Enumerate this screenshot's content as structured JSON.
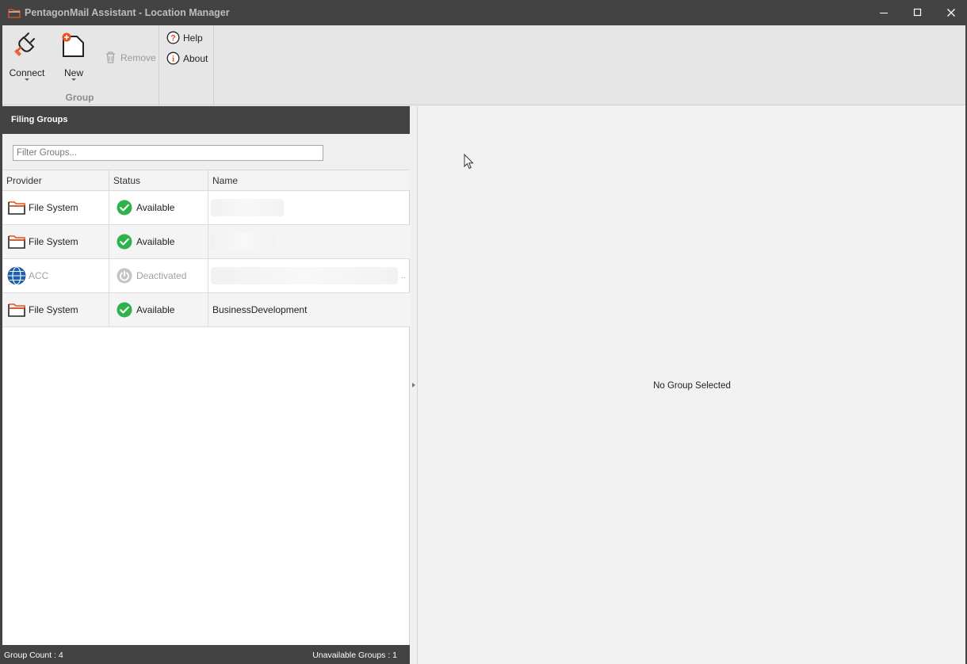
{
  "window": {
    "title": "PentagonMail Assistant - Location Manager",
    "controls": [
      "minimize",
      "maximize",
      "close"
    ]
  },
  "ribbon": {
    "connect_label": "Connect",
    "new_label": "New",
    "remove_label": "Remove",
    "group_label": "Group",
    "help_label": "Help",
    "about_label": "About"
  },
  "filing_groups": {
    "header": "Filing Groups",
    "filter_placeholder": "Filter Groups...",
    "columns": {
      "provider": "Provider",
      "status": "Status",
      "name": "Name"
    },
    "rows": [
      {
        "provider": "File System",
        "status": "Available",
        "name": "",
        "name_redacted": true,
        "deactivated": false,
        "provider_icon": "folder-icon",
        "status_icon": "check-circle-icon"
      },
      {
        "provider": "File System",
        "status": "Available",
        "name": "",
        "name_redacted": true,
        "deactivated": false,
        "provider_icon": "folder-icon",
        "status_icon": "check-circle-icon"
      },
      {
        "provider": "ACC",
        "status": "Deactivated",
        "name": "",
        "name_redacted": true,
        "deactivated": true,
        "provider_icon": "globe-icon",
        "status_icon": "power-icon"
      },
      {
        "provider": "File System",
        "status": "Available",
        "name": "BusinessDevelopment",
        "name_redacted": false,
        "deactivated": false,
        "provider_icon": "folder-icon",
        "status_icon": "check-circle-icon"
      }
    ],
    "status_bar": {
      "group_count": "Group Count : 4",
      "unavailable_groups": "Unavailable Groups : 1"
    }
  },
  "detail": {
    "empty_message": "No Group Selected"
  },
  "colors": {
    "titlebar": "#434343",
    "accent_orange": "#e8501e",
    "available_green": "#2db34a",
    "globe_blue": "#1f5fb0"
  }
}
